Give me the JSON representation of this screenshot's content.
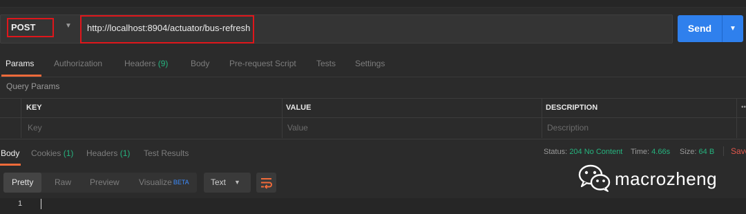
{
  "request": {
    "method": "POST",
    "url": "http://localhost:8904/actuator/bus-refresh",
    "send_label": "Send"
  },
  "request_tabs": [
    {
      "label": "Params",
      "active": true
    },
    {
      "label": "Authorization"
    },
    {
      "label": "Headers",
      "count": "(9)"
    },
    {
      "label": "Body"
    },
    {
      "label": "Pre-request Script"
    },
    {
      "label": "Tests"
    },
    {
      "label": "Settings"
    }
  ],
  "query_params": {
    "title": "Query Params",
    "columns": [
      "KEY",
      "VALUE",
      "DESCRIPTION"
    ],
    "more": "•••",
    "placeholders": [
      "Key",
      "Value",
      "Description"
    ]
  },
  "response_tabs": [
    {
      "label": "Body",
      "active": true
    },
    {
      "label": "Cookies",
      "count": "(1)"
    },
    {
      "label": "Headers",
      "count": "(1)"
    },
    {
      "label": "Test Results"
    }
  ],
  "response_status": {
    "status_label": "Status:",
    "status_value": "204 No Content",
    "time_label": "Time:",
    "time_value": "4.66s",
    "size_label": "Size:",
    "size_value": "64 B",
    "save_label": "Save"
  },
  "view_modes": [
    {
      "label": "Pretty",
      "active": true
    },
    {
      "label": "Raw"
    },
    {
      "label": "Preview"
    },
    {
      "label": "Visualize",
      "badge": "BETA"
    }
  ],
  "format": {
    "selected": "Text"
  },
  "editor": {
    "line_numbers": [
      "1"
    ]
  },
  "watermark": {
    "text": "macrozheng",
    "icon": "wechat-icon"
  },
  "colors": {
    "accent_orange": "#f26b3a",
    "send_blue": "#2f80ed",
    "status_green": "#26b47f",
    "highlight_red": "#e0161b"
  }
}
